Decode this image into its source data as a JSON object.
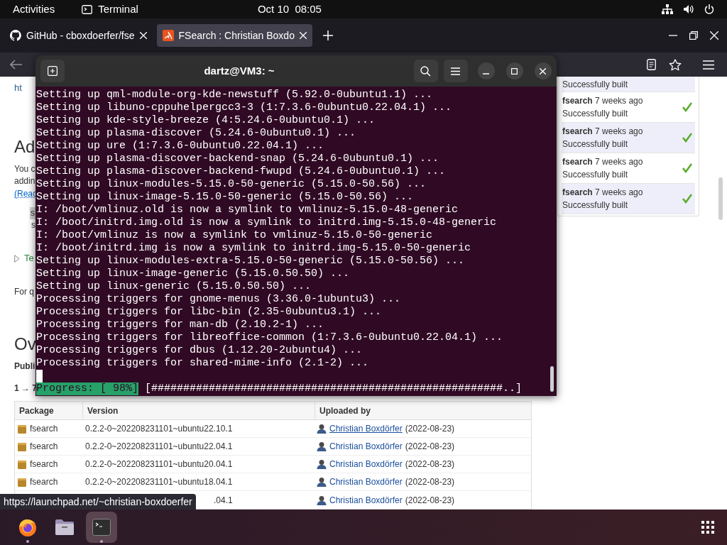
{
  "top_bar": {
    "activities": "Activities",
    "app": "Terminal",
    "clock": "Oct 10  08:05"
  },
  "browser": {
    "tabs": [
      {
        "title": "GitHub - cboxdoerfer/fse",
        "selected": false
      },
      {
        "title": "FSearch : Christian Boxdo",
        "selected": true
      }
    ],
    "page": {
      "fragments": [
        {
          "kind": "link",
          "text": "ht"
        },
        {
          "kind": "heading",
          "text": "Ad"
        },
        {
          "kind": "text",
          "text": "You c"
        },
        {
          "kind": "text",
          "text": "addin"
        },
        {
          "kind": "link_dotted",
          "text": "(Reac"
        },
        {
          "kind": "code",
          "text": "s"
        },
        {
          "kind": "code_plain",
          "text": "s"
        },
        {
          "kind": "expander",
          "text": "Te"
        },
        {
          "kind": "text",
          "text": "For q"
        },
        {
          "kind": "heading",
          "text": "Ov"
        },
        {
          "kind": "bold",
          "text": "Publi"
        },
        {
          "kind": "bold",
          "text": "1 → 7"
        }
      ],
      "builds": [
        {
          "status": "Successfully built"
        },
        {
          "name": "fsearch",
          "age": "7 weeks ago",
          "status": "Successfully built",
          "ok": true
        },
        {
          "name": "fsearch",
          "age": "7 weeks ago",
          "status": "Successfully built",
          "ok": true
        },
        {
          "name": "fsearch",
          "age": "7 weeks ago",
          "status": "Successfully built",
          "ok": true
        },
        {
          "name": "fsearch",
          "age": "7 weeks ago",
          "status": "Successfully built",
          "ok": true
        }
      ],
      "table": {
        "columns": [
          "Package",
          "Version",
          "Uploaded by"
        ],
        "rows": [
          {
            "package": "fsearch",
            "version": "0.2.2-0~202208231101~ubuntu22.10.1",
            "uploader": "Christian Boxdörfer",
            "date": "(2022-08-23)",
            "hovered": true,
            "covered": false
          },
          {
            "package": "fsearch",
            "version": "0.2.2-0~202208231101~ubuntu22.04.1",
            "uploader": "Christian Boxdörfer",
            "date": "(2022-08-23)",
            "hovered": false,
            "covered": false
          },
          {
            "package": "fsearch",
            "version": "0.2.2-0~202208231101~ubuntu20.04.1",
            "uploader": "Christian Boxdörfer",
            "date": "(2022-08-23)",
            "hovered": false,
            "covered": false
          },
          {
            "package": "fsearch",
            "version": "0.2.2-0~202208231101~ubuntu18.04.1",
            "uploader": "Christian Boxdörfer",
            "date": "(2022-08-23)",
            "hovered": false,
            "covered": false
          },
          {
            "version": ".04.1",
            "uploader": "Christian Boxdörfer",
            "date": "(2022-08-23)",
            "hovered": false,
            "covered": true
          }
        ]
      }
    },
    "status_url": "https://launchpad.net/~christian-boxdoerfer"
  },
  "terminal": {
    "title": "dartz@VM3: ~",
    "lines": [
      "Setting up qml-module-org-kde-newstuff (5.92.0-0ubuntu1.1) ...",
      "Setting up libuno-cppuhelpergcc3-3 (1:7.3.6-0ubuntu0.22.04.1) ...",
      "Setting up kde-style-breeze (4:5.24.6-0ubuntu0.1) ...",
      "Setting up plasma-discover (5.24.6-0ubuntu0.1) ...",
      "Setting up ure (1:7.3.6-0ubuntu0.22.04.1) ...",
      "Setting up plasma-discover-backend-snap (5.24.6-0ubuntu0.1) ...",
      "Setting up plasma-discover-backend-fwupd (5.24.6-0ubuntu0.1) ...",
      "Setting up linux-modules-5.15.0-50-generic (5.15.0-50.56) ...",
      "Setting up linux-image-5.15.0-50-generic (5.15.0-50.56) ...",
      "I: /boot/vmlinuz.old is now a symlink to vmlinuz-5.15.0-48-generic",
      "I: /boot/initrd.img.old is now a symlink to initrd.img-5.15.0-48-generic",
      "I: /boot/vmlinuz is now a symlink to vmlinuz-5.15.0-50-generic",
      "I: /boot/initrd.img is now a symlink to initrd.img-5.15.0-50-generic",
      "Setting up linux-modules-extra-5.15.0-50-generic (5.15.0-50.56) ...",
      "Setting up linux-image-generic (5.15.0.50.50) ...",
      "Setting up linux-generic (5.15.0.50.50) ...",
      "Processing triggers for gnome-menus (3.36.0-1ubuntu3) ...",
      "Processing triggers for libc-bin (2.35-0ubuntu3.1) ...",
      "Processing triggers for man-db (2.10.2-1) ...",
      "Processing triggers for libreoffice-common (1:7.3.6-0ubuntu0.22.04.1) ...",
      "Processing triggers for dbus (1.12.20-2ubuntu4) ...",
      "Processing triggers for shared-mime-info (2.1-2) ..."
    ],
    "progress": {
      "label": "Progress: [ 98%]",
      "bar": "[#######################################################..]"
    }
  },
  "dock": {
    "apps": [
      {
        "kind": "firefox",
        "running": true,
        "selected": false
      },
      {
        "kind": "files",
        "running": false,
        "selected": false
      },
      {
        "kind": "terminal",
        "running": true,
        "selected": true
      }
    ]
  }
}
